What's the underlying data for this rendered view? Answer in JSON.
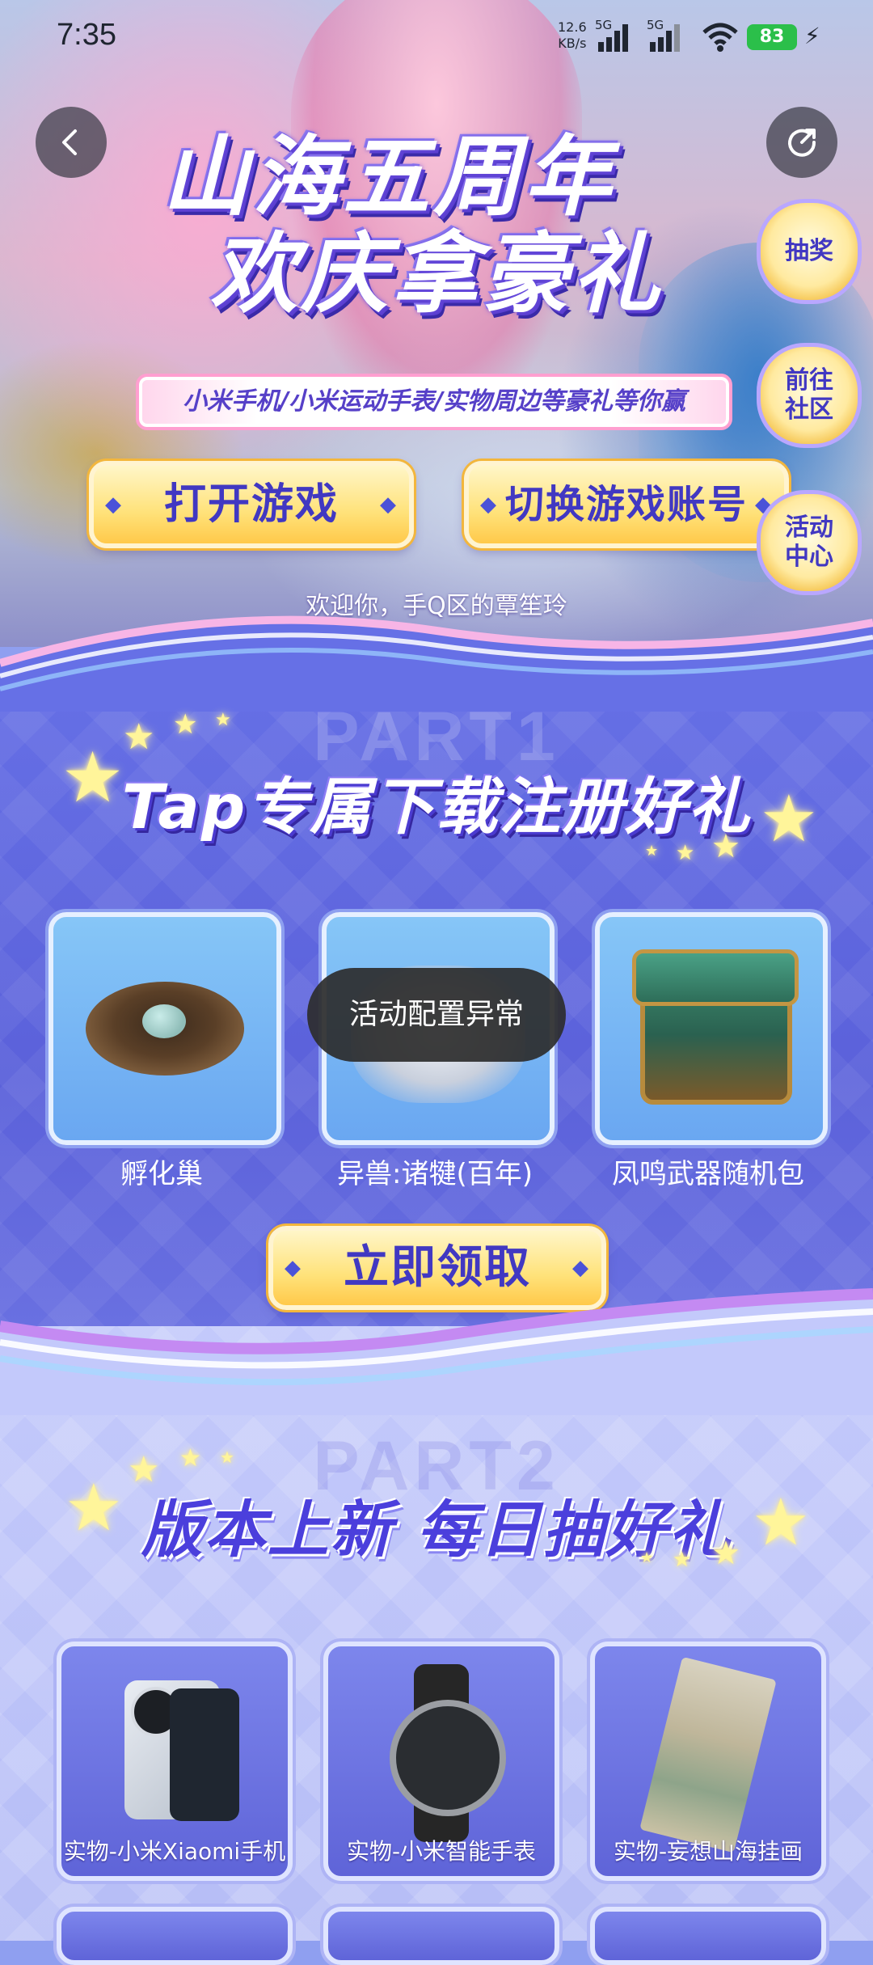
{
  "status_bar": {
    "time": "7:35",
    "net_speed_value": "12.6",
    "net_speed_unit": "KB/s",
    "signal1_label": "5G",
    "signal2_label": "5G",
    "battery": "83"
  },
  "hero": {
    "title_line1": "山海五周年",
    "title_line2": "欢庆拿豪礼",
    "subtitle": "小米手机/小米运动手表/实物周边等豪礼等你赢",
    "open_game_label": "打开游戏",
    "switch_account_label": "切换游戏账号",
    "welcome": "欢迎你，手Q区的覃笙玲"
  },
  "side_menu": [
    {
      "label": "抽奖"
    },
    {
      "label": "前往\n社区"
    },
    {
      "label": "活动\n中心"
    }
  ],
  "section1": {
    "ghost": "PART1",
    "heading": "Tap专属下载注册好礼",
    "rewards": [
      {
        "name": "孵化巢"
      },
      {
        "name": "异兽:诸犍(百年)"
      },
      {
        "name": "凤鸣武器随机包"
      }
    ],
    "claim_label": "立即领取"
  },
  "toast": "活动配置异常",
  "section2": {
    "ghost": "PART2",
    "heading": "版本上新 每日抽好礼",
    "prizes": [
      {
        "name": "实物-小米Xiaomi手机"
      },
      {
        "name": "实物-小米智能手表"
      },
      {
        "name": "实物-妄想山海挂画"
      }
    ]
  },
  "colors": {
    "accent_purple": "#4138c2",
    "gold_button": "#ffe27a",
    "battery_green": "#2bbf4a",
    "section1_bg": "#5b61da",
    "section2_bg": "#c3c9fb"
  }
}
